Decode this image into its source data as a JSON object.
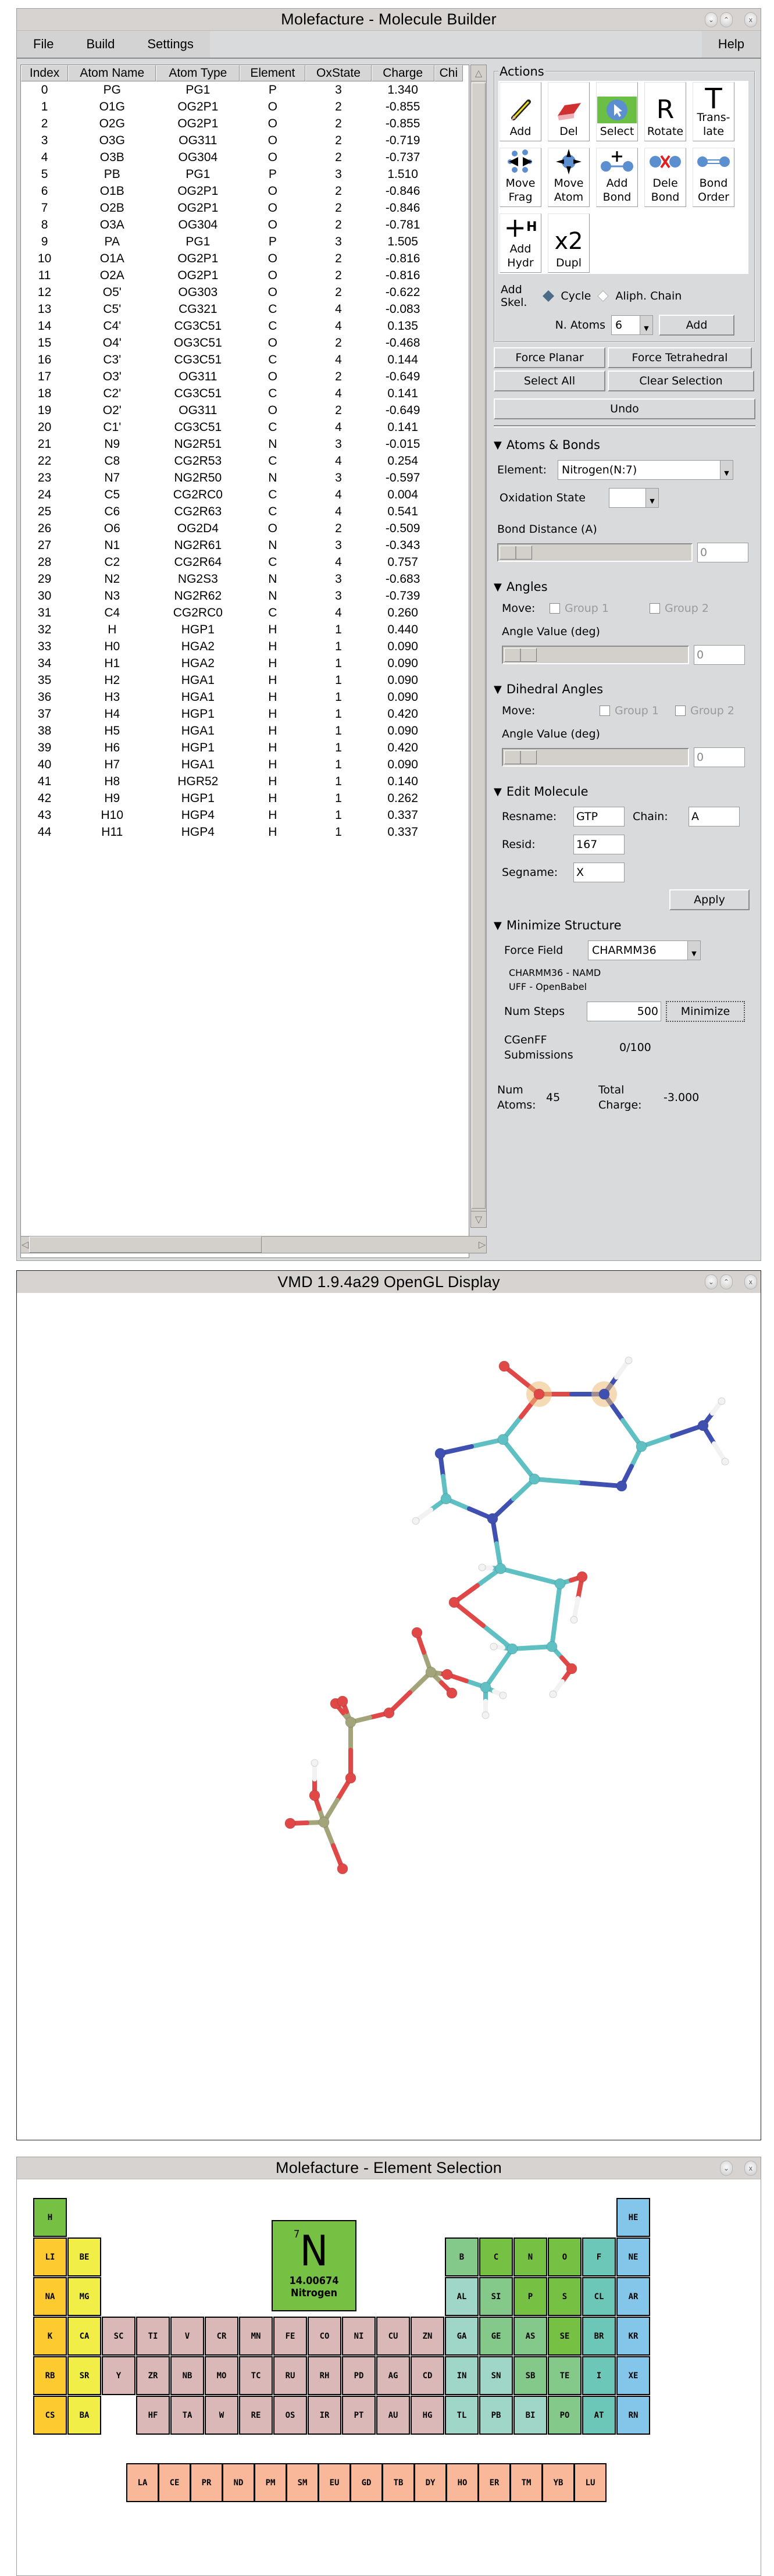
{
  "builder": {
    "title": "Molefacture - Molecule Builder",
    "menu": {
      "file": "File",
      "build": "Build",
      "settings": "Settings",
      "help": "Help"
    },
    "window_buttons": {
      "minimize": "v",
      "maximize": "^",
      "close": "x"
    },
    "table": {
      "columns": [
        "Index",
        "Atom Name",
        "Atom Type",
        "Element",
        "OxState",
        "Charge",
        "Chi"
      ],
      "rows": [
        [
          "0",
          "PG",
          "PG1",
          "P",
          "3",
          "1.340"
        ],
        [
          "1",
          "O1G",
          "OG2P1",
          "O",
          "2",
          "-0.855"
        ],
        [
          "2",
          "O2G",
          "OG2P1",
          "O",
          "2",
          "-0.855"
        ],
        [
          "3",
          "O3G",
          "OG311",
          "O",
          "2",
          "-0.719"
        ],
        [
          "4",
          "O3B",
          "OG304",
          "O",
          "2",
          "-0.737"
        ],
        [
          "5",
          "PB",
          "PG1",
          "P",
          "3",
          "1.510"
        ],
        [
          "6",
          "O1B",
          "OG2P1",
          "O",
          "2",
          "-0.846"
        ],
        [
          "7",
          "O2B",
          "OG2P1",
          "O",
          "2",
          "-0.846"
        ],
        [
          "8",
          "O3A",
          "OG304",
          "O",
          "2",
          "-0.781"
        ],
        [
          "9",
          "PA",
          "PG1",
          "P",
          "3",
          "1.505"
        ],
        [
          "10",
          "O1A",
          "OG2P1",
          "O",
          "2",
          "-0.816"
        ],
        [
          "11",
          "O2A",
          "OG2P1",
          "O",
          "2",
          "-0.816"
        ],
        [
          "12",
          "O5'",
          "OG303",
          "O",
          "2",
          "-0.622"
        ],
        [
          "13",
          "C5'",
          "CG321",
          "C",
          "4",
          "-0.083"
        ],
        [
          "14",
          "C4'",
          "CG3C51",
          "C",
          "4",
          "0.135"
        ],
        [
          "15",
          "O4'",
          "OG3C51",
          "O",
          "2",
          "-0.468"
        ],
        [
          "16",
          "C3'",
          "CG3C51",
          "C",
          "4",
          "0.144"
        ],
        [
          "17",
          "O3'",
          "OG311",
          "O",
          "2",
          "-0.649"
        ],
        [
          "18",
          "C2'",
          "CG3C51",
          "C",
          "4",
          "0.141"
        ],
        [
          "19",
          "O2'",
          "OG311",
          "O",
          "2",
          "-0.649"
        ],
        [
          "20",
          "C1'",
          "CG3C51",
          "C",
          "4",
          "0.141"
        ],
        [
          "21",
          "N9",
          "NG2R51",
          "N",
          "3",
          "-0.015"
        ],
        [
          "22",
          "C8",
          "CG2R53",
          "C",
          "4",
          "0.254"
        ],
        [
          "23",
          "N7",
          "NG2R50",
          "N",
          "3",
          "-0.597"
        ],
        [
          "24",
          "C5",
          "CG2RC0",
          "C",
          "4",
          "0.004"
        ],
        [
          "25",
          "C6",
          "CG2R63",
          "C",
          "4",
          "0.541"
        ],
        [
          "26",
          "O6",
          "OG2D4",
          "O",
          "2",
          "-0.509"
        ],
        [
          "27",
          "N1",
          "NG2R61",
          "N",
          "3",
          "-0.343"
        ],
        [
          "28",
          "C2",
          "CG2R64",
          "C",
          "4",
          "0.757"
        ],
        [
          "29",
          "N2",
          "NG2S3",
          "N",
          "3",
          "-0.683"
        ],
        [
          "30",
          "N3",
          "NG2R62",
          "N",
          "3",
          "-0.739"
        ],
        [
          "31",
          "C4",
          "CG2RC0",
          "C",
          "4",
          "0.260"
        ],
        [
          "32",
          "H",
          "HGP1",
          "H",
          "1",
          "0.440"
        ],
        [
          "33",
          "H0",
          "HGA2",
          "H",
          "1",
          "0.090"
        ],
        [
          "34",
          "H1",
          "HGA2",
          "H",
          "1",
          "0.090"
        ],
        [
          "35",
          "H2",
          "HGA1",
          "H",
          "1",
          "0.090"
        ],
        [
          "36",
          "H3",
          "HGA1",
          "H",
          "1",
          "0.090"
        ],
        [
          "37",
          "H4",
          "HGP1",
          "H",
          "1",
          "0.420"
        ],
        [
          "38",
          "H5",
          "HGA1",
          "H",
          "1",
          "0.090"
        ],
        [
          "39",
          "H6",
          "HGP1",
          "H",
          "1",
          "0.420"
        ],
        [
          "40",
          "H7",
          "HGA1",
          "H",
          "1",
          "0.090"
        ],
        [
          "41",
          "H8",
          "HGR52",
          "H",
          "1",
          "0.140"
        ],
        [
          "42",
          "H9",
          "HGP1",
          "H",
          "1",
          "0.262"
        ],
        [
          "43",
          "H10",
          "HGP4",
          "H",
          "1",
          "0.337"
        ],
        [
          "44",
          "H11",
          "HGP4",
          "H",
          "1",
          "0.337"
        ]
      ]
    },
    "actions": {
      "legend": "Actions",
      "tools": [
        {
          "id": "add",
          "label": "Add",
          "icon": "pencil-icon"
        },
        {
          "id": "del",
          "label": "Del",
          "icon": "eraser-icon"
        },
        {
          "id": "select",
          "label": "Select",
          "icon": "cursor-icon",
          "selected": true
        },
        {
          "id": "rotate",
          "label": "Rotate",
          "icon": "R"
        },
        {
          "id": "translate",
          "label": "Trans-\nlate",
          "icon": "T"
        },
        {
          "id": "move-frag",
          "label": "Move\nFrag",
          "icon": "move-fragment-icon"
        },
        {
          "id": "move-atom",
          "label": "Move\nAtom",
          "icon": "move-atom-icon"
        },
        {
          "id": "add-bond",
          "label": "Add\nBond",
          "icon": "add-bond-icon"
        },
        {
          "id": "dele-bond",
          "label": "Dele\nBond",
          "icon": "delete-bond-icon"
        },
        {
          "id": "bond-order",
          "label": "Bond\nOrder",
          "icon": "bond-order-icon"
        },
        {
          "id": "add-hydr",
          "label": "Add\nHydr",
          "icon": "+H"
        },
        {
          "id": "dupl",
          "label": "Dupl",
          "icon": "x2"
        }
      ],
      "add_skel_label": "Add\nSkel.",
      "skel_options": [
        {
          "label": "Cycle",
          "selected": true
        },
        {
          "label": "Aliph. Chain",
          "selected": false
        }
      ],
      "n_atoms_label": "N. Atoms",
      "n_atoms_value": "6",
      "add_button": "Add"
    },
    "buttons": {
      "force_planar": "Force Planar",
      "force_tetrahedral": "Force Tetrahedral",
      "select_all": "Select All",
      "clear_selection": "Clear Selection",
      "undo": "Undo"
    },
    "atoms_bonds": {
      "header": "Atoms & Bonds",
      "element_label": "Element:",
      "element_value": "Nitrogen(N:7)",
      "oxidation_label": "Oxidation State",
      "oxidation_value": "",
      "bond_distance_label": "Bond Distance (A)",
      "bond_distance_value": "0"
    },
    "angles": {
      "header": "Angles",
      "move_label": "Move:",
      "group1": "Group 1",
      "group2": "Group 2",
      "value_label": "Angle Value (deg)",
      "value": "0"
    },
    "dihedrals": {
      "header": "Dihedral Angles",
      "move_label": "Move:",
      "group1": "Group 1",
      "group2": "Group 2",
      "value_label": "Angle Value (deg)",
      "value": "0"
    },
    "edit_molecule": {
      "header": "Edit Molecule",
      "resname_label": "Resname:",
      "resname_value": "GTP",
      "chain_label": "Chain:",
      "chain_value": "A",
      "resid_label": "Resid:",
      "resid_value": "167",
      "segname_label": "Segname:",
      "segname_value": "X",
      "apply": "Apply"
    },
    "minimize": {
      "header": "Minimize Structure",
      "force_field_label": "Force Field",
      "force_field_value": "CHARMM36",
      "ff_note_1": "CHARMM36 - NAMD",
      "ff_note_2": "UFF - OpenBabel",
      "num_steps_label": "Num Steps",
      "num_steps_value": "500",
      "minimize_button": "Minimize",
      "cgenff_label": "CGenFF\nSubmissions",
      "cgenff_value": "0/100"
    },
    "summary": {
      "num_atoms_label": "Num\nAtoms:",
      "num_atoms_value": "45",
      "total_charge_label": "Total\nCharge:",
      "total_charge_value": "-3.000"
    }
  },
  "vmd": {
    "title": "VMD 1.9.4a29 OpenGL Display",
    "molecule": "GTP",
    "atom_colors": {
      "C": "#5fc0c4",
      "N": "#4050b0",
      "O": "#e04848",
      "P": "#a4a47a",
      "H": "#f2f2f2"
    }
  },
  "elements": {
    "title": "Molefacture - Element Selection",
    "selected": {
      "number": "7",
      "symbol": "N",
      "mass": "14.00674",
      "name": "Nitrogen"
    },
    "colors": {
      "alkali": "#fdcb30",
      "alkaline": "#f2ee48",
      "transition": "#dbb8b8",
      "nonmetal": "#76c043",
      "metalloid": "#85c98a",
      "post_transition": "#9fd6c8",
      "halogen": "#6cc7b8",
      "noble": "#84c6ea",
      "lanthanide": "#f9b899"
    },
    "main_table": [
      {
        "s": "H",
        "r": 0,
        "c": 0,
        "g": "nonmetal"
      },
      {
        "s": "HE",
        "r": 0,
        "c": 17,
        "g": "noble"
      },
      {
        "s": "LI",
        "r": 1,
        "c": 0,
        "g": "alkali"
      },
      {
        "s": "BE",
        "r": 1,
        "c": 1,
        "g": "alkaline"
      },
      {
        "s": "B",
        "r": 1,
        "c": 12,
        "g": "metalloid"
      },
      {
        "s": "C",
        "r": 1,
        "c": 13,
        "g": "nonmetal"
      },
      {
        "s": "N",
        "r": 1,
        "c": 14,
        "g": "nonmetal"
      },
      {
        "s": "O",
        "r": 1,
        "c": 15,
        "g": "nonmetal"
      },
      {
        "s": "F",
        "r": 1,
        "c": 16,
        "g": "halogen"
      },
      {
        "s": "NE",
        "r": 1,
        "c": 17,
        "g": "noble"
      },
      {
        "s": "NA",
        "r": 2,
        "c": 0,
        "g": "alkali"
      },
      {
        "s": "MG",
        "r": 2,
        "c": 1,
        "g": "alkaline"
      },
      {
        "s": "AL",
        "r": 2,
        "c": 12,
        "g": "post_transition"
      },
      {
        "s": "SI",
        "r": 2,
        "c": 13,
        "g": "metalloid"
      },
      {
        "s": "P",
        "r": 2,
        "c": 14,
        "g": "nonmetal"
      },
      {
        "s": "S",
        "r": 2,
        "c": 15,
        "g": "nonmetal"
      },
      {
        "s": "CL",
        "r": 2,
        "c": 16,
        "g": "halogen"
      },
      {
        "s": "AR",
        "r": 2,
        "c": 17,
        "g": "noble"
      },
      {
        "s": "K",
        "r": 3,
        "c": 0,
        "g": "alkali"
      },
      {
        "s": "CA",
        "r": 3,
        "c": 1,
        "g": "alkaline"
      },
      {
        "s": "SC",
        "r": 3,
        "c": 2,
        "g": "transition"
      },
      {
        "s": "TI",
        "r": 3,
        "c": 3,
        "g": "transition"
      },
      {
        "s": "V",
        "r": 3,
        "c": 4,
        "g": "transition"
      },
      {
        "s": "CR",
        "r": 3,
        "c": 5,
        "g": "transition"
      },
      {
        "s": "MN",
        "r": 3,
        "c": 6,
        "g": "transition"
      },
      {
        "s": "FE",
        "r": 3,
        "c": 7,
        "g": "transition"
      },
      {
        "s": "CO",
        "r": 3,
        "c": 8,
        "g": "transition"
      },
      {
        "s": "NI",
        "r": 3,
        "c": 9,
        "g": "transition"
      },
      {
        "s": "CU",
        "r": 3,
        "c": 10,
        "g": "transition"
      },
      {
        "s": "ZN",
        "r": 3,
        "c": 11,
        "g": "transition"
      },
      {
        "s": "GA",
        "r": 3,
        "c": 12,
        "g": "post_transition"
      },
      {
        "s": "GE",
        "r": 3,
        "c": 13,
        "g": "metalloid"
      },
      {
        "s": "AS",
        "r": 3,
        "c": 14,
        "g": "metalloid"
      },
      {
        "s": "SE",
        "r": 3,
        "c": 15,
        "g": "nonmetal"
      },
      {
        "s": "BR",
        "r": 3,
        "c": 16,
        "g": "halogen"
      },
      {
        "s": "KR",
        "r": 3,
        "c": 17,
        "g": "noble"
      },
      {
        "s": "RB",
        "r": 4,
        "c": 0,
        "g": "alkali"
      },
      {
        "s": "SR",
        "r": 4,
        "c": 1,
        "g": "alkaline"
      },
      {
        "s": "Y",
        "r": 4,
        "c": 2,
        "g": "transition"
      },
      {
        "s": "ZR",
        "r": 4,
        "c": 3,
        "g": "transition"
      },
      {
        "s": "NB",
        "r": 4,
        "c": 4,
        "g": "transition"
      },
      {
        "s": "MO",
        "r": 4,
        "c": 5,
        "g": "transition"
      },
      {
        "s": "TC",
        "r": 4,
        "c": 6,
        "g": "transition"
      },
      {
        "s": "RU",
        "r": 4,
        "c": 7,
        "g": "transition"
      },
      {
        "s": "RH",
        "r": 4,
        "c": 8,
        "g": "transition"
      },
      {
        "s": "PD",
        "r": 4,
        "c": 9,
        "g": "transition"
      },
      {
        "s": "AG",
        "r": 4,
        "c": 10,
        "g": "transition"
      },
      {
        "s": "CD",
        "r": 4,
        "c": 11,
        "g": "transition"
      },
      {
        "s": "IN",
        "r": 4,
        "c": 12,
        "g": "post_transition"
      },
      {
        "s": "SN",
        "r": 4,
        "c": 13,
        "g": "post_transition"
      },
      {
        "s": "SB",
        "r": 4,
        "c": 14,
        "g": "metalloid"
      },
      {
        "s": "TE",
        "r": 4,
        "c": 15,
        "g": "metalloid"
      },
      {
        "s": "I",
        "r": 4,
        "c": 16,
        "g": "halogen"
      },
      {
        "s": "XE",
        "r": 4,
        "c": 17,
        "g": "noble"
      },
      {
        "s": "CS",
        "r": 5,
        "c": 0,
        "g": "alkali"
      },
      {
        "s": "BA",
        "r": 5,
        "c": 1,
        "g": "alkaline"
      },
      {
        "s": "HF",
        "r": 5,
        "c": 3,
        "g": "transition"
      },
      {
        "s": "TA",
        "r": 5,
        "c": 4,
        "g": "transition"
      },
      {
        "s": "W",
        "r": 5,
        "c": 5,
        "g": "transition"
      },
      {
        "s": "RE",
        "r": 5,
        "c": 6,
        "g": "transition"
      },
      {
        "s": "OS",
        "r": 5,
        "c": 7,
        "g": "transition"
      },
      {
        "s": "IR",
        "r": 5,
        "c": 8,
        "g": "transition"
      },
      {
        "s": "PT",
        "r": 5,
        "c": 9,
        "g": "transition"
      },
      {
        "s": "AU",
        "r": 5,
        "c": 10,
        "g": "transition"
      },
      {
        "s": "HG",
        "r": 5,
        "c": 11,
        "g": "transition"
      },
      {
        "s": "TL",
        "r": 5,
        "c": 12,
        "g": "post_transition"
      },
      {
        "s": "PB",
        "r": 5,
        "c": 13,
        "g": "post_transition"
      },
      {
        "s": "BI",
        "r": 5,
        "c": 14,
        "g": "post_transition"
      },
      {
        "s": "PO",
        "r": 5,
        "c": 15,
        "g": "metalloid"
      },
      {
        "s": "AT",
        "r": 5,
        "c": 16,
        "g": "halogen"
      },
      {
        "s": "RN",
        "r": 5,
        "c": 17,
        "g": "noble"
      }
    ],
    "lanthanides": [
      "LA",
      "CE",
      "PR",
      "ND",
      "PM",
      "SM",
      "EU",
      "GD",
      "TB",
      "DY",
      "HO",
      "ER",
      "TM",
      "YB",
      "LU"
    ]
  }
}
